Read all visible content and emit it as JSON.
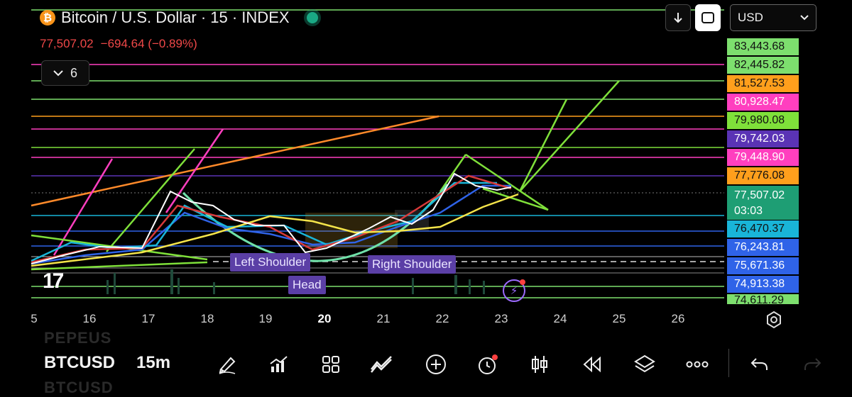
{
  "header": {
    "title": "Bitcoin / U.S. Dollar · 15 · INDEX",
    "price": "77,507.02",
    "change": "−694.64 (−0.89%)",
    "indicator_count": "6",
    "currency": "USD"
  },
  "price_scale": [
    {
      "value": "83,443.68",
      "color": "#7ddf6e"
    },
    {
      "value": "82,445.82",
      "color": "#7ddf6e"
    },
    {
      "value": "81,527.53",
      "color": "#ff9f1c"
    },
    {
      "value": "80,928.47",
      "color": "#ff3fbf"
    },
    {
      "value": "79,980.08",
      "color": "#7fe03a"
    },
    {
      "value": "79,742.03",
      "color": "#5a33b5"
    },
    {
      "value": "79,448.90",
      "color": "#ff3fbf"
    },
    {
      "value": "77,776.08",
      "color": "#ff9f1c"
    },
    {
      "value": "76,470.37",
      "color": "#19b5d8"
    },
    {
      "value": "76,243.81",
      "color": "#2f63e8"
    },
    {
      "value": "75,671.36",
      "color": "#2f63e8"
    },
    {
      "value": "74,913.38",
      "color": "#2f63e8"
    },
    {
      "value": "74,611.29",
      "color": "#7ddf6e"
    }
  ],
  "current_price": {
    "value": "77,507.02",
    "countdown": "03:03"
  },
  "time_axis": [
    "5",
    "16",
    "17",
    "18",
    "19",
    "20",
    "21",
    "22",
    "23",
    "24",
    "25",
    "26"
  ],
  "annotations": {
    "left_shoulder": "Left Shoulder",
    "head": "Head",
    "right_shoulder": "Right Shoulder"
  },
  "bottom_bar": {
    "ghost_top": "PEPEUS",
    "symbol": "BTCUSD",
    "timeframe": "15m",
    "ghost_bottom": "BTCUSD"
  }
}
